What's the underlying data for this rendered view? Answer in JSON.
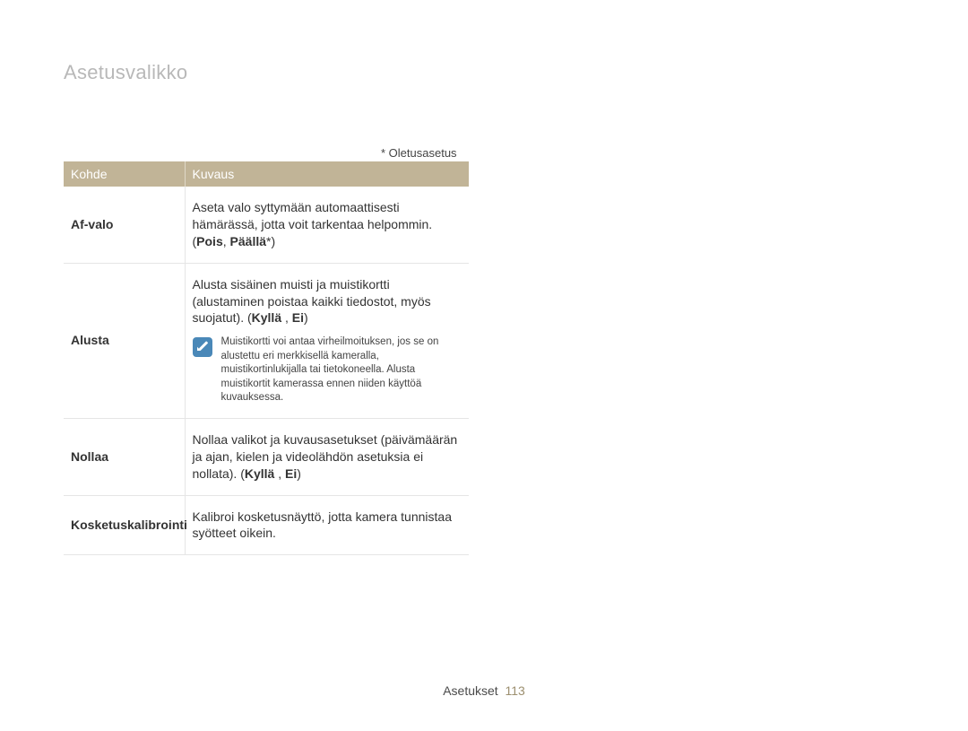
{
  "page": {
    "title": "Asetusvalikko",
    "default_note": "* Oletusasetus",
    "footer_label": "Asetukset",
    "page_number": "113"
  },
  "table": {
    "header_label": "Kohde",
    "header_desc": "Kuvaus",
    "rows": {
      "afvalo": {
        "label": "Af-valo",
        "desc_prefix": "Aseta valo syttymään automaattisesti hämärässä, jotta voit tarkentaa helpommin. (",
        "opt1": "Pois",
        "sep": ", ",
        "opt2": "Päällä",
        "opt2_suffix": "*",
        "desc_suffix": ")"
      },
      "alusta": {
        "label": "Alusta",
        "desc_prefix": "Alusta sisäinen muisti ja muistikortti (alustaminen poistaa kaikki tiedostot, myös suojatut). (",
        "opt1": "Kyllä ",
        "sep": ", ",
        "opt2": "Ei",
        "desc_suffix": ")",
        "note": "Muistikortti voi antaa virheilmoituksen, jos se on alustettu eri merkkisellä kameralla, muistikortinlukijalla tai tietokoneella. Alusta muistikortit kamerassa ennen niiden käyttöä kuvauksessa."
      },
      "nollaa": {
        "label": "Nollaa",
        "desc_prefix": "Nollaa valikot ja kuvausasetukset (päivämäärän ja ajan, kielen ja videolähdön asetuksia ei nollata). (",
        "opt1": "Kyllä ",
        "sep": ", ",
        "opt2": "Ei",
        "desc_suffix": ")"
      },
      "kosketus": {
        "label": "Kosketuskalibrointi",
        "desc": "Kalibroi kosketusnäyttö, jotta kamera tunnistaa syötteet oikein."
      }
    }
  }
}
